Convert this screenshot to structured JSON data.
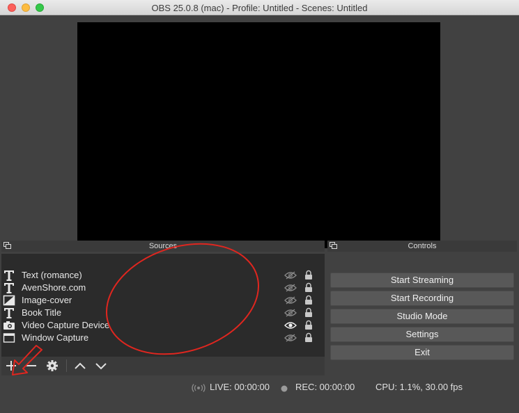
{
  "window": {
    "title": "OBS 25.0.8 (mac) - Profile: Untitled - Scenes: Untitled"
  },
  "docks": {
    "sources_title": "Sources",
    "controls_title": "Controls"
  },
  "sources": [
    {
      "label": "Text (romance)",
      "icon": "text-icon",
      "visible": false
    },
    {
      "label": "AvenShore.com",
      "icon": "text-icon",
      "visible": false
    },
    {
      "label": "Image-cover",
      "icon": "image-icon",
      "visible": false
    },
    {
      "label": "Book Title",
      "icon": "text-icon",
      "visible": false
    },
    {
      "label": "Video Capture Device",
      "icon": "camera-icon",
      "visible": true
    },
    {
      "label": "Window Capture",
      "icon": "window-icon",
      "visible": false
    }
  ],
  "toolbar": {
    "icons": [
      "plus-icon",
      "minus-icon",
      "gear-icon",
      "chevron-up-icon",
      "chevron-down-icon"
    ]
  },
  "controls": {
    "start_streaming": "Start Streaming",
    "start_recording": "Start Recording",
    "studio_mode": "Studio Mode",
    "settings": "Settings",
    "exit": "Exit"
  },
  "status": {
    "live": "LIVE: 00:00:00",
    "rec": "REC: 00:00:00",
    "cpu": "CPU: 1.1%, 30.00 fps"
  },
  "colors": {
    "annotation": "#e0261f",
    "preview": "#000000",
    "panel": "#2b2b2b"
  }
}
